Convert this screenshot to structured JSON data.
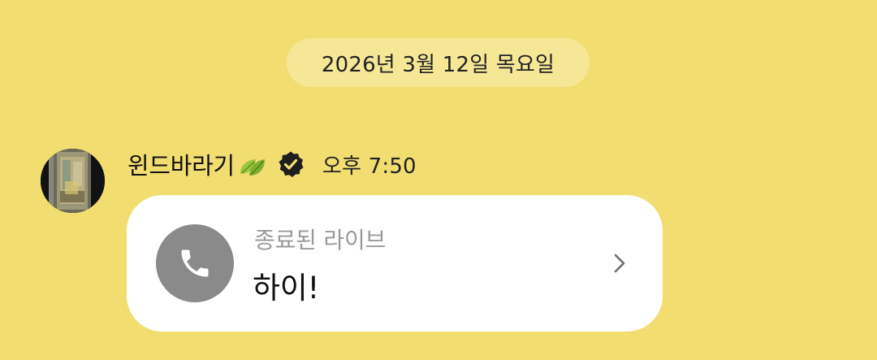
{
  "date_divider": "2026년 3월 12일 목요일",
  "message": {
    "sender": {
      "name": "윈드바라기",
      "name_emoji_icon": "leaf-icon",
      "badge_icon": "verified-badge-icon",
      "avatar_icon": "profile-avatar"
    },
    "time": "오후 7:50",
    "call_card": {
      "icon": "phone-icon",
      "status": "종료된 라이브",
      "text": "하이!",
      "arrow_icon": "chevron-right-icon"
    }
  },
  "colors": {
    "background": "#F2DD71",
    "date_pill": "#F6E797",
    "card": "#FFFFFF",
    "call_icon_bg": "#8A8A8A",
    "status_text": "#9A9A9A"
  }
}
